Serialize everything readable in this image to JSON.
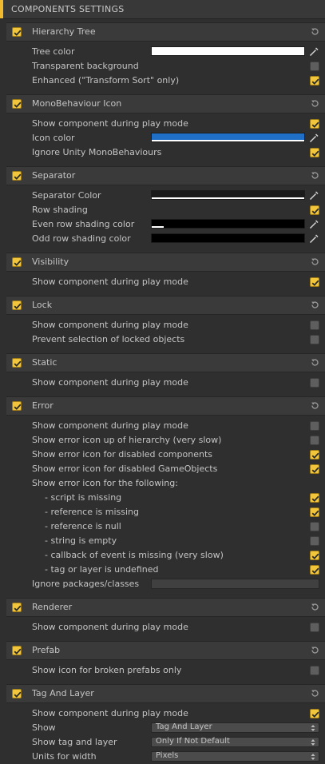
{
  "header": {
    "title": "COMPONENTS SETTINGS"
  },
  "colors": {
    "accent": "#f2c63c",
    "icon_blue": "#1f6fc7"
  },
  "sections": [
    {
      "label": "Hierarchy Tree",
      "checked": true,
      "rows": [
        {
          "type": "color",
          "label": "Tree color",
          "swatch": "#ffffff",
          "strip_pct": 23
        },
        {
          "type": "check",
          "label": "Transparent background",
          "checked": false
        },
        {
          "type": "check",
          "label": "Enhanced (\"Transform Sort\" only)",
          "checked": true
        }
      ]
    },
    {
      "label": "MonoBehaviour Icon",
      "checked": true,
      "rows": [
        {
          "type": "check",
          "label": "Show component during play mode",
          "checked": true
        },
        {
          "type": "color",
          "label": "Icon color",
          "swatch": "#1f6fc7",
          "strip_pct": 100
        },
        {
          "type": "check",
          "label": "Ignore Unity MonoBehaviours",
          "checked": true
        }
      ]
    },
    {
      "label": "Separator",
      "checked": true,
      "rows": [
        {
          "type": "color",
          "label": "Separator Color",
          "swatch": "#1a1a1a",
          "strip_pct": 100
        },
        {
          "type": "check",
          "label": "Row shading",
          "checked": true
        },
        {
          "type": "color",
          "label": "Even row shading color",
          "swatch": "#000000",
          "strip_pct": 8
        },
        {
          "type": "color",
          "label": "Odd row shading color",
          "swatch": "#000000",
          "strip_pct": 0
        }
      ]
    },
    {
      "label": "Visibility",
      "checked": true,
      "rows": [
        {
          "type": "check",
          "label": "Show component during play mode",
          "checked": true
        }
      ]
    },
    {
      "label": "Lock",
      "checked": true,
      "rows": [
        {
          "type": "check",
          "label": "Show component during play mode",
          "checked": false
        },
        {
          "type": "check",
          "label": "Prevent selection of locked objects",
          "checked": false
        }
      ]
    },
    {
      "label": "Static",
      "checked": true,
      "rows": [
        {
          "type": "check",
          "label": "Show component during play mode",
          "checked": false
        }
      ]
    },
    {
      "label": "Error",
      "checked": true,
      "rows": [
        {
          "type": "check",
          "label": "Show component during play mode",
          "checked": false
        },
        {
          "type": "check",
          "label": "Show error icon up of hierarchy (very slow)",
          "checked": false
        },
        {
          "type": "check",
          "label": "Show error icon for disabled components",
          "checked": true
        },
        {
          "type": "check",
          "label": "Show error icon for disabled GameObjects",
          "checked": true
        },
        {
          "type": "text",
          "label": "Show error icon for the following:"
        },
        {
          "type": "check",
          "label": "- script is missing",
          "checked": true,
          "indent": true
        },
        {
          "type": "check",
          "label": "- reference is missing",
          "checked": true,
          "indent": true
        },
        {
          "type": "check",
          "label": "- reference is null",
          "checked": false,
          "indent": true
        },
        {
          "type": "check",
          "label": "- string is empty",
          "checked": false,
          "indent": true
        },
        {
          "type": "check",
          "label": "- callback of event is missing (very slow)",
          "checked": true,
          "indent": true
        },
        {
          "type": "check",
          "label": "- tag or layer is undefined",
          "checked": true,
          "indent": true
        },
        {
          "type": "field",
          "label": "Ignore packages/classes",
          "value": ""
        }
      ]
    },
    {
      "label": "Renderer",
      "checked": true,
      "rows": [
        {
          "type": "check",
          "label": "Show component during play mode",
          "checked": false
        }
      ]
    },
    {
      "label": "Prefab",
      "checked": true,
      "rows": [
        {
          "type": "check",
          "label": "Show icon for broken prefabs only",
          "checked": false
        }
      ]
    },
    {
      "label": "Tag And Layer",
      "checked": true,
      "rows": [
        {
          "type": "check",
          "label": "Show component during play mode",
          "checked": true
        },
        {
          "type": "dropdown",
          "label": "Show",
          "value": "Tag And Layer"
        },
        {
          "type": "dropdown",
          "label": "Show tag and layer",
          "value": "Only If Not Default"
        },
        {
          "type": "dropdown",
          "label": "Units for width",
          "value": "Pixels"
        }
      ]
    }
  ]
}
